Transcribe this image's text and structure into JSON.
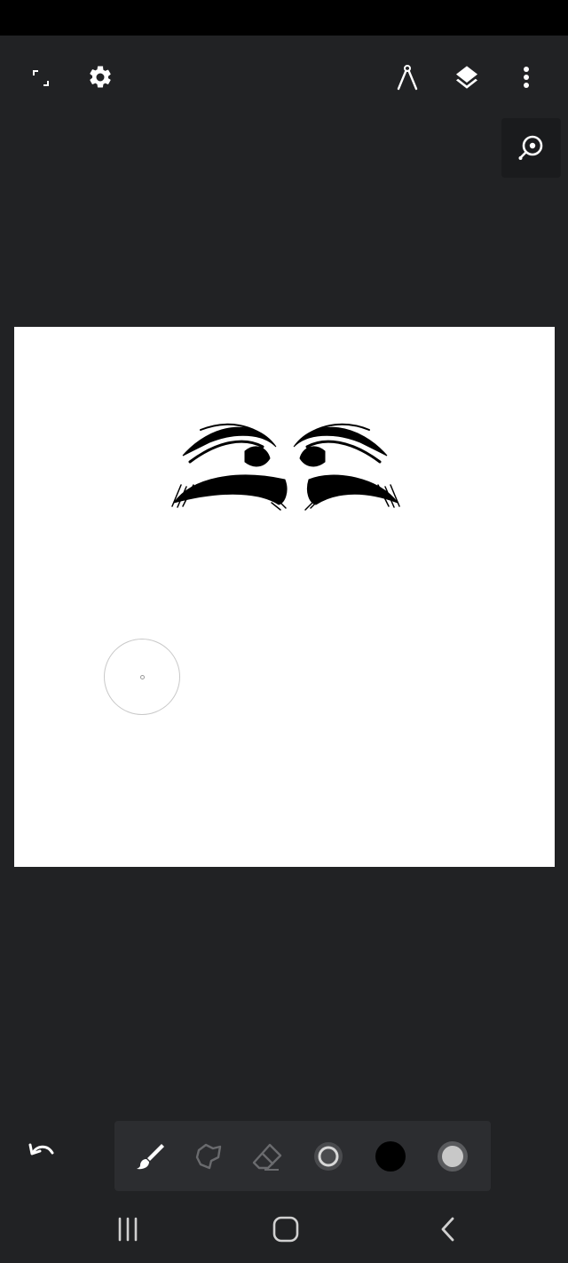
{
  "app": {
    "accent_colors": {
      "background": "#212224",
      "canvas": "#ffffff",
      "toolbar": "#2c2d30",
      "current_color": "#000000"
    }
  },
  "top_bar": {
    "icons": [
      "fullscreen-icon",
      "settings-icon",
      "compass-icon",
      "layers-icon",
      "more-vertical-icon"
    ]
  },
  "zoom_button": {
    "icon": "zoom-icon"
  },
  "toolbar": {
    "tools": [
      "brush-icon",
      "lasso-icon",
      "eraser-icon",
      "brush-size-icon",
      "color-swatch",
      "opacity-icon"
    ],
    "active_tool": "brush",
    "color": "#000000"
  },
  "undo": {
    "icon": "undo-icon"
  },
  "system_nav": {
    "icons": [
      "recents-icon",
      "home-icon",
      "back-icon"
    ]
  }
}
